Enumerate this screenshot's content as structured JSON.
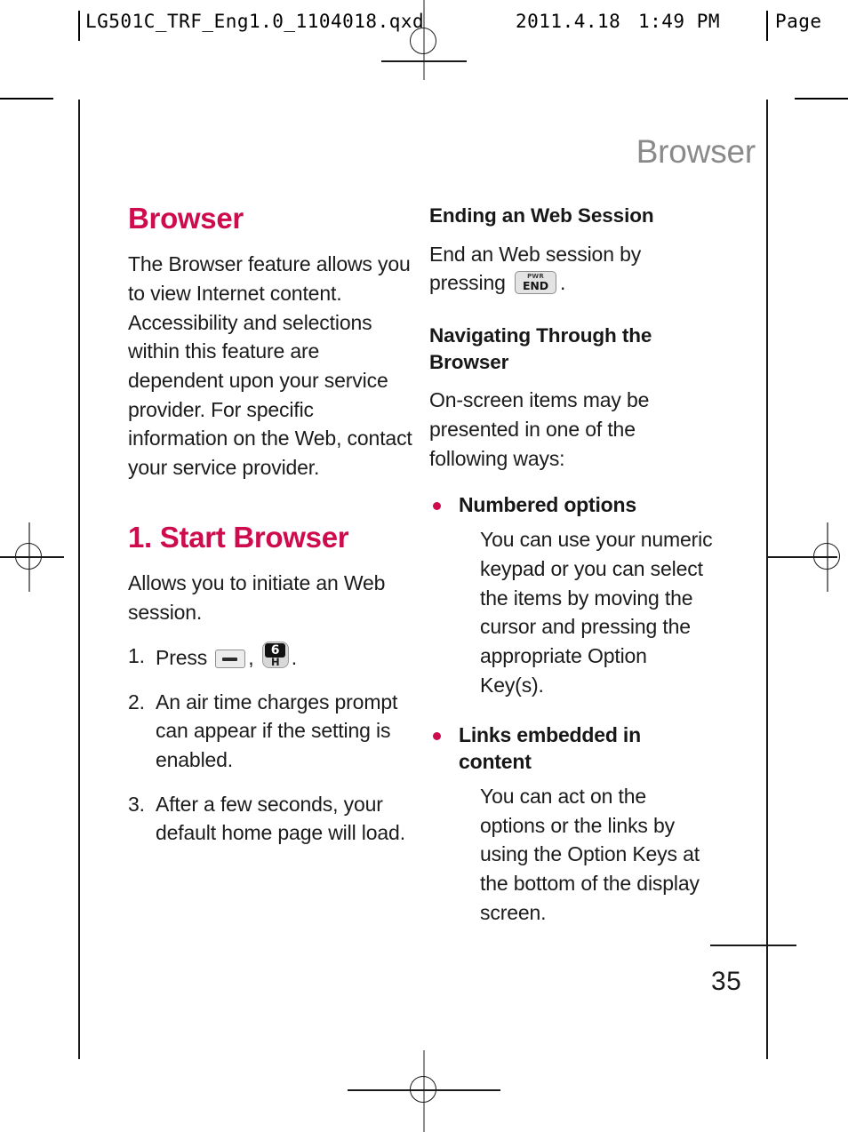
{
  "prepress": {
    "file_stamp": "LG501C_TRF_Eng1.0_1104018.qxd",
    "date_stamp": "2011.4.18",
    "time_stamp": "1:49 PM",
    "page_stamp": "Page"
  },
  "running_header": "Browser",
  "folio": {
    "page_number": "35"
  },
  "colors": {
    "accent_crimson": "#ce0b4c",
    "header_gray": "#8a8a8a",
    "body_black": "#1b1b1b"
  },
  "left_column": {
    "heading": "Browser",
    "intro_paragraph": "The Browser feature allows you to view Internet content. Accessibility and selections within this feature are dependent upon your service provider. For specific information on the Web, contact your service provider.",
    "section_heading": "1. Start Browser",
    "section_intro": "Allows you to initiate an Web session.",
    "steps": [
      {
        "number": "1.",
        "text_before": "Press",
        "key_one": {
          "type": "soft-key-bar",
          "label": ""
        },
        "separator": ",",
        "key_two": {
          "type": "numeric-key",
          "digit": "6",
          "letter": "H"
        },
        "text_after": "."
      },
      {
        "number": "2.",
        "text": "An air time charges prompt can appear if the setting is enabled."
      },
      {
        "number": "3.",
        "text": "After a few seconds, your default home page will load."
      }
    ]
  },
  "right_column": {
    "ending_section": {
      "heading": "Ending an Web Session",
      "text_before": "End an Web session by pressing",
      "key": {
        "type": "power-end-key",
        "top_label": "PWR",
        "main_label": "END"
      },
      "text_after": "."
    },
    "navigating_section": {
      "heading": "Navigating Through the Browser",
      "intro": "On-screen items may be presented in one of the following ways:",
      "bullets": [
        {
          "title": "Numbered options",
          "text": "You can use your numeric keypad or you can select the items by moving the cursor and pressing the appropriate Option Key(s)."
        },
        {
          "title": "Links embedded in content",
          "text": "You can act on the options or the links by using the Option Keys at the bottom of the display screen."
        }
      ]
    }
  }
}
